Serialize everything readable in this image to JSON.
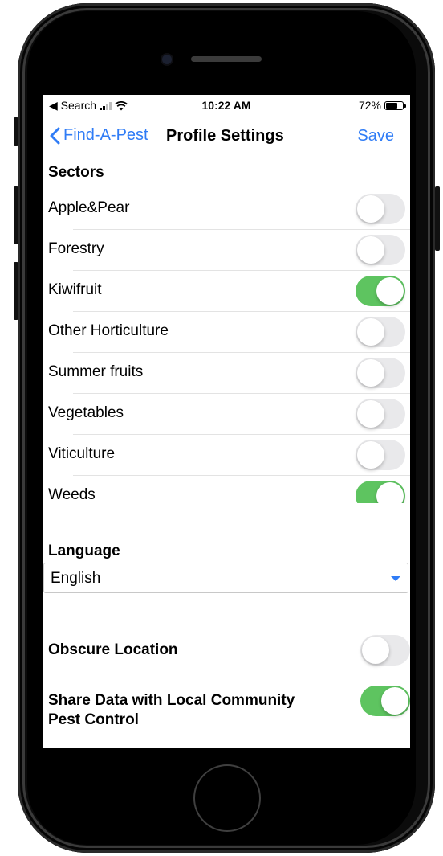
{
  "status_bar": {
    "back_app": "◀ Search",
    "time": "10:22 AM",
    "battery": "72%",
    "battery_level": 0.72
  },
  "nav": {
    "back_label": "Find-A-Pest",
    "title": "Profile Settings",
    "save_label": "Save"
  },
  "sectors": {
    "header": "Sectors",
    "items": [
      {
        "label": "Apple&Pear",
        "on": false
      },
      {
        "label": "Forestry",
        "on": false
      },
      {
        "label": "Kiwifruit",
        "on": true
      },
      {
        "label": "Other Horticulture",
        "on": false
      },
      {
        "label": "Summer fruits",
        "on": false
      },
      {
        "label": "Vegetables",
        "on": false
      },
      {
        "label": "Viticulture",
        "on": false
      },
      {
        "label": "Weeds",
        "on": true
      }
    ]
  },
  "language": {
    "header": "Language",
    "selected": "English"
  },
  "obscure_location": {
    "label": "Obscure Location",
    "on": false
  },
  "share_data": {
    "label_line1": "Share Data with Local Community",
    "label_line2": "Pest Control",
    "on": true
  },
  "colors": {
    "accent": "#2f7cf6",
    "toggle_on": "#5ec460",
    "toggle_off": "#e9e9eb"
  }
}
